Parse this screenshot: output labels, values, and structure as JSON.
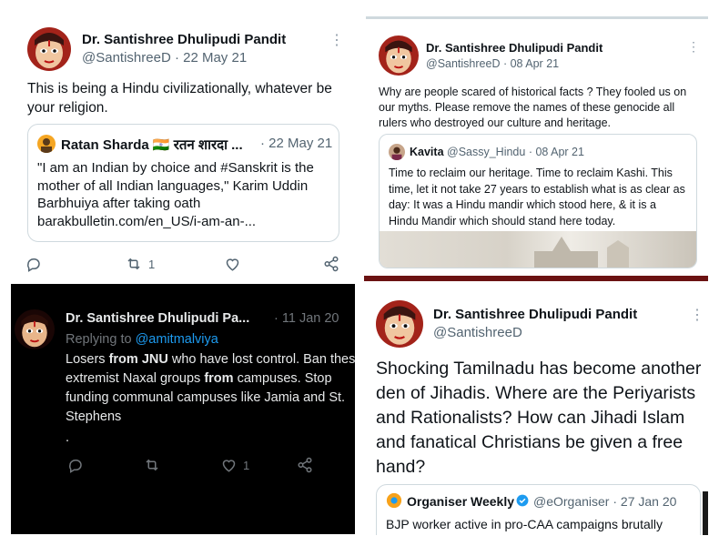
{
  "tweet1": {
    "name": "Dr. Santishree Dhulipudi Pandit",
    "handle": "@SantishreeD",
    "date": "· 22 May 21",
    "text": "This is being a Hindu civilizationally, whatever be your religion.",
    "quote": {
      "name": "Ratan Sharda 🇮🇳 रतन शारदा ...",
      "date": "· 22 May 21",
      "text": "\"I am an Indian by choice and #Sanskrit is the mother of all Indian languages,\" Karim Uddin Barbhuiya after taking oath barakbulletin.com/en_US/i-am-an-..."
    },
    "retweet_count": "1",
    "icons": [
      "reply-icon",
      "retweet-icon",
      "like-icon",
      "share-icon"
    ]
  },
  "tweet2": {
    "name": "Dr. Santishree Dhulipudi Pandit",
    "handle": "@SantishreeD · 08 Apr 21",
    "text": "Why are people scared of historical facts ? They fooled us on our myths. Please remove the names of these genocide all rulers who destroyed our culture and heritage.",
    "quote": {
      "name": "Kavita",
      "handle": "@Sassy_Hindu · 08 Apr 21",
      "text": "Time to reclaim our heritage. Time to reclaim Kashi.  This time, let it not take 27 years to establish what is as clear as day: It was a Hindu mandir which stood here, & it is a Hindu Mandir which should stand here today."
    }
  },
  "tweet3": {
    "name": "Dr. Santishree Dhulipudi Pa...",
    "date": "· 11 Jan 20",
    "replying_label": "Replying to",
    "replying_to": "@amitmalviya",
    "text_parts": [
      {
        "t": "Losers ",
        "b": false
      },
      {
        "t": "from JNU",
        "b": true
      },
      {
        "t": " who have lost control. Ban these extremist Naxal groups ",
        "b": false
      },
      {
        "t": "from",
        "b": true
      },
      {
        "t": " campuses. Stop funding communal campuses like Jamia and St. Stephens",
        "b": false
      }
    ],
    "trailing": ".",
    "like_count": "1",
    "icons": [
      "reply-icon",
      "retweet-icon",
      "like-icon",
      "share-icon"
    ]
  },
  "tweet4": {
    "name": "Dr. Santishree Dhulipudi Pandit",
    "handle": "@SantishreeD",
    "text": "Shocking Tamilnadu has become another den of Jihadis. Where are the Periyarists and Rationalists? How can Jihadi Islam and fanatical Christians be given a free hand?",
    "quote": {
      "name": "Organiser Weekly",
      "handle": "@eOrganiser · 27 Jan 20",
      "text": "BJP worker active in pro-CAA campaigns brutally"
    }
  },
  "colors": {
    "accent": "#1d9bf0",
    "dark_bg": "#000000",
    "dark_text": "#e7e9ea",
    "muted": "#536471",
    "divider_red": "#6b1212"
  }
}
